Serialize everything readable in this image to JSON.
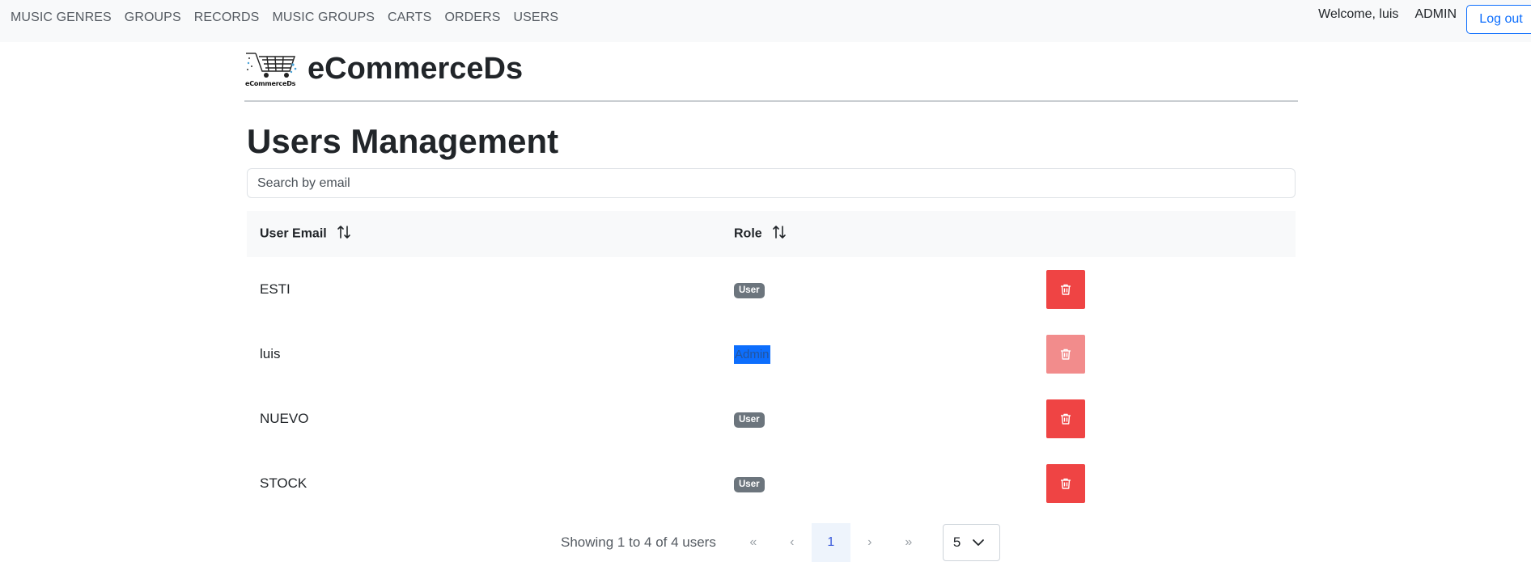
{
  "nav": {
    "links": [
      "MUSIC GENRES",
      "GROUPS",
      "RECORDS",
      "MUSIC GROUPS",
      "CARTS",
      "ORDERS",
      "USERS"
    ],
    "welcome": "Welcome, luis",
    "role": "ADMIN",
    "logout_label": "Log out"
  },
  "brand": {
    "name": "eCommerceDs",
    "logo_text": "eCommerceDs"
  },
  "page": {
    "title": "Users Management"
  },
  "search": {
    "placeholder": "Search by email",
    "value": ""
  },
  "table": {
    "headers": {
      "email": "User Email",
      "role": "Role"
    },
    "rows": [
      {
        "email": "ESTI",
        "role": "User"
      },
      {
        "email": "luis",
        "role": "Admin"
      },
      {
        "email": "NUEVO",
        "role": "User"
      },
      {
        "email": "STOCK",
        "role": "User"
      }
    ]
  },
  "pagination": {
    "summary": "Showing 1 to 4 of 4 users",
    "first": "«",
    "prev": "‹",
    "current": "1",
    "next": "›",
    "last": "»",
    "page_size": "5"
  },
  "colors": {
    "accent": "#0d6efd",
    "danger": "#ef4444",
    "badge": "#6c757d"
  },
  "icons": [
    "cart-logo-icon",
    "sort-icon",
    "trash-icon",
    "chevron-down-icon"
  ]
}
